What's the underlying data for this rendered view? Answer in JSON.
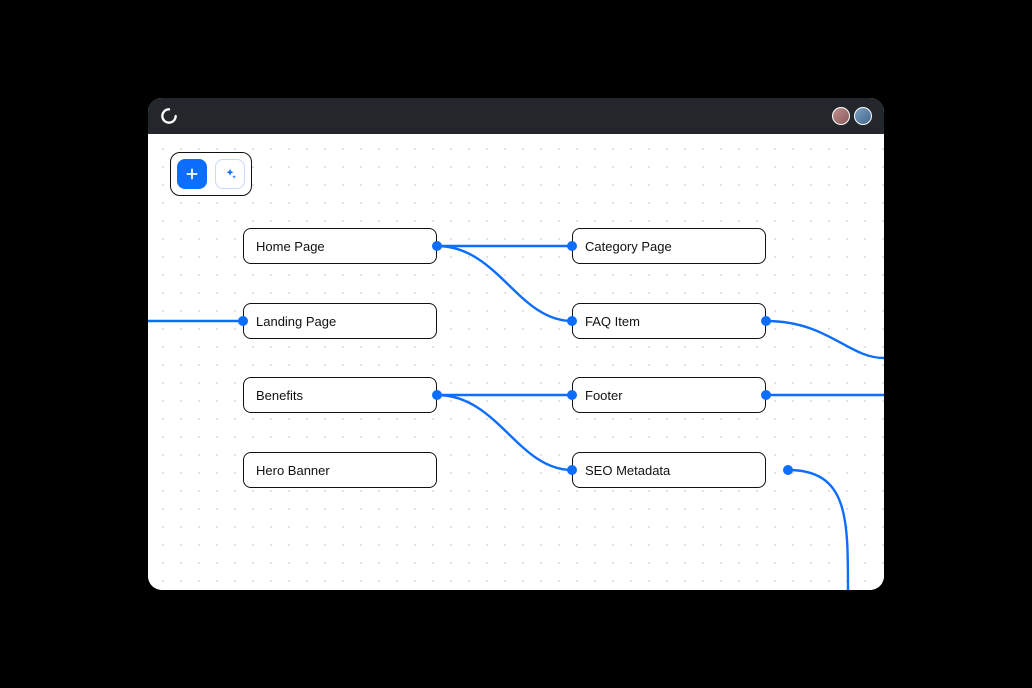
{
  "colors": {
    "accent": "#0d6efd",
    "titlebar": "#23272b",
    "node_border": "#111111"
  },
  "toolbar": {
    "add_icon": "plus-icon",
    "ai_icon": "sparkle-icon"
  },
  "nodes": {
    "home_page": {
      "label": "Home Page"
    },
    "landing_page": {
      "label": "Landing Page"
    },
    "benefits": {
      "label": "Benefits"
    },
    "hero_banner": {
      "label": "Hero Banner"
    },
    "category_page": {
      "label": "Category Page"
    },
    "faq_item": {
      "label": "FAQ Item"
    },
    "footer": {
      "label": "Footer"
    },
    "seo_metadata": {
      "label": "SEO Metadata"
    }
  },
  "connections": [
    {
      "from": "home_page",
      "to": "category_page"
    },
    {
      "from": "home_page",
      "to": "faq_item"
    },
    {
      "from": "benefits",
      "to": "footer"
    },
    {
      "from": "benefits",
      "to": "seo_metadata"
    },
    {
      "from": "canvas-left-edge",
      "to": "landing_page"
    },
    {
      "from": "faq_item",
      "to": "canvas-right-edge"
    },
    {
      "from": "footer",
      "to": "canvas-right-edge"
    },
    {
      "from": "seo_metadata",
      "to": "canvas-bottom-edge"
    }
  ]
}
